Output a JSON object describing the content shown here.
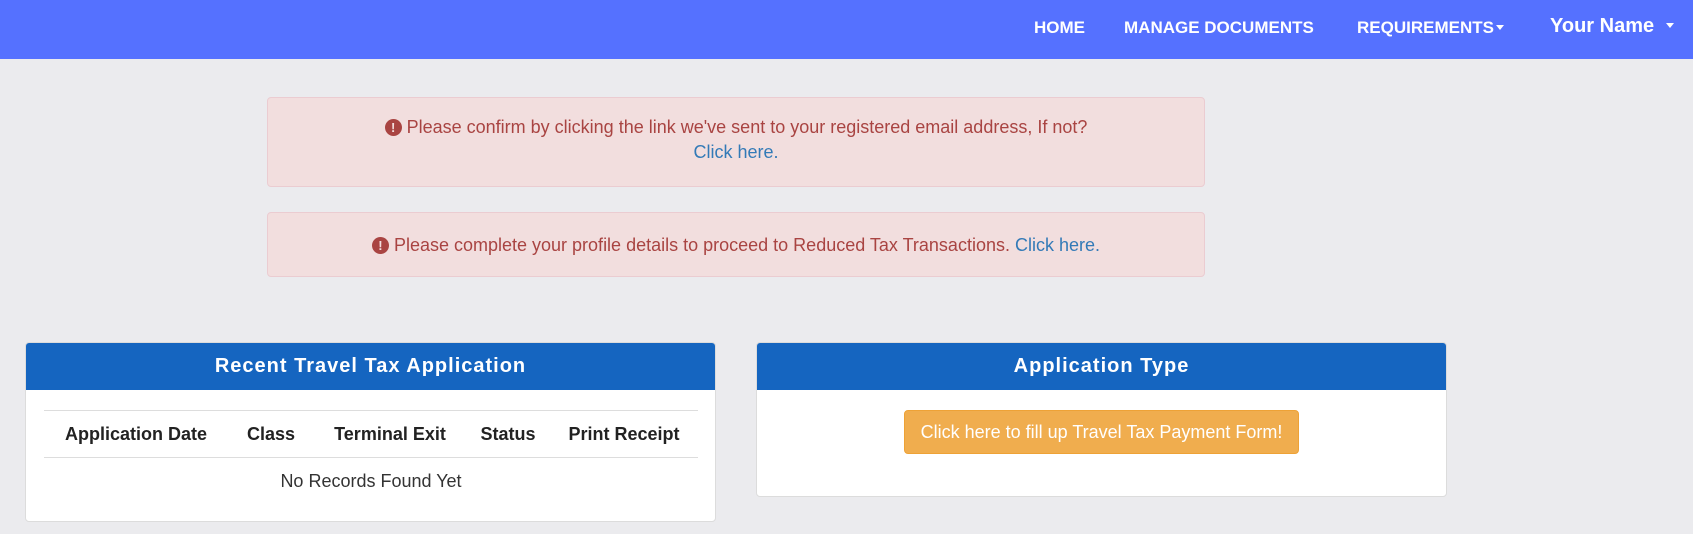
{
  "navbar": {
    "items": [
      {
        "label": "HOME"
      },
      {
        "label": "MANAGE DOCUMENTS"
      },
      {
        "label": "REQUIREMENTS"
      }
    ],
    "user_name": "Your Name"
  },
  "alerts": {
    "email_confirm": {
      "message": "Please confirm by clicking the link we've sent to your registered email address, If not?",
      "link_text": "Click here",
      "suffix": "."
    },
    "profile_complete": {
      "message": "Please complete your profile details to proceed to Reduced Tax Transactions.",
      "link_text": "Click here",
      "suffix": "."
    }
  },
  "recent_panel": {
    "title": "Recent Travel Tax Application",
    "columns": [
      "Application Date",
      "Class",
      "Terminal Exit",
      "Status",
      "Print Receipt"
    ],
    "empty_text": "No Records Found Yet"
  },
  "application_type_panel": {
    "title": "Application Type",
    "button_label": "Click here to fill up Travel Tax Payment Form!"
  },
  "colors": {
    "navbar": "#5571ff",
    "panel_heading": "#1565c0",
    "alert_bg": "#f2dede",
    "alert_text": "#a94442",
    "button": "#f0ad4e"
  }
}
